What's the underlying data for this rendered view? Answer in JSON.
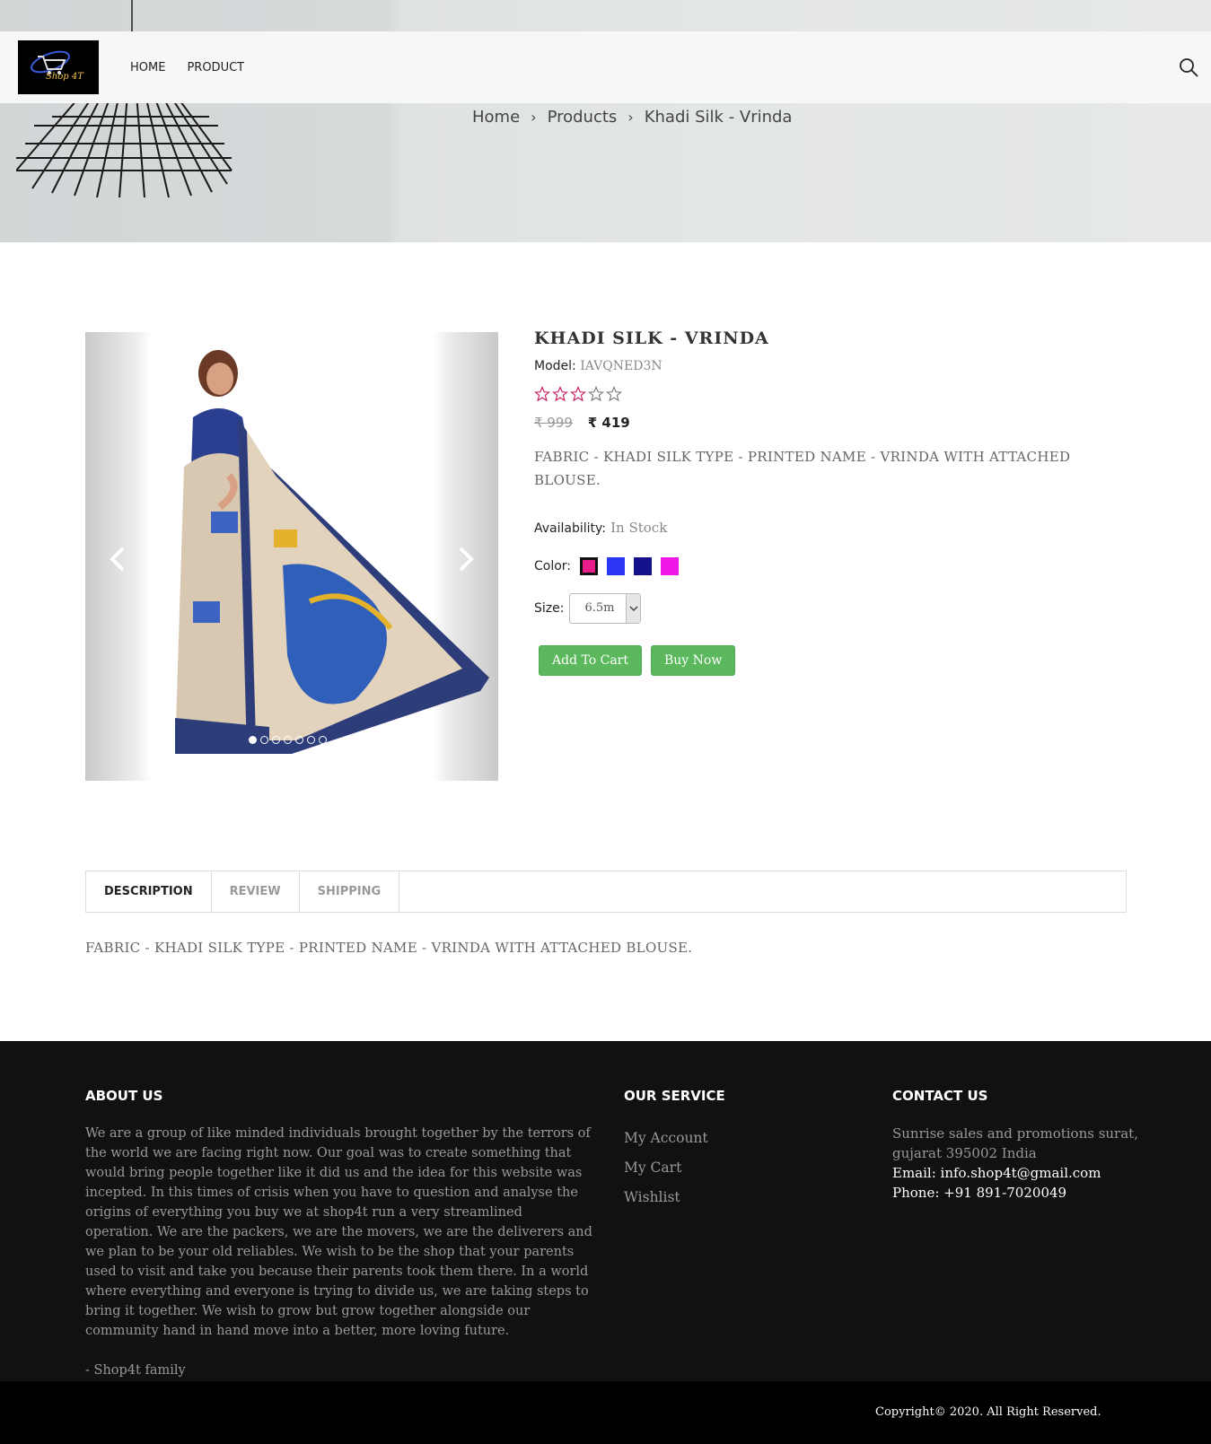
{
  "header": {
    "logo_text": "Shop 4T",
    "nav": [
      "HOME",
      "PRODUCT"
    ]
  },
  "breadcrumb": [
    "Home",
    "Products",
    "Khadi Silk - Vrinda"
  ],
  "product": {
    "title": "KHADI SILK - VRINDA",
    "model_label": "Model:",
    "model": "IAVQNED3N",
    "rating": 0,
    "rating_max": 5,
    "old_price": "₹ 999",
    "new_price": "₹ 419",
    "short_description": "FABRIC - KHADI SILK TYPE - PRINTED NAME - VRINDA WITH ATTACHED BLOUSE.",
    "availability_label": "Availability:",
    "availability": "In Stock",
    "color_label": "Color:",
    "colors": [
      "#e91e8c",
      "#2b36f5",
      "#15128c",
      "#f018e6"
    ],
    "selected_color_index": 0,
    "size_label": "Size:",
    "size_selected": "6.5m",
    "add_to_cart": "Add To Cart",
    "buy_now": "Buy Now",
    "slides_total": 7,
    "active_slide": 1
  },
  "tabs": {
    "items": [
      "DESCRIPTION",
      "REVIEW",
      "SHIPPING"
    ],
    "active": "DESCRIPTION",
    "description": "FABRIC - KHADI SILK TYPE - PRINTED NAME - VRINDA WITH ATTACHED BLOUSE."
  },
  "footer": {
    "about_title": "ABOUT US",
    "about_text": "We are a group of like minded individuals brought together by the terrors of the world we are facing right now. Our goal was to create something that would bring people together like it did us and the idea for this website was incepted. In this times of crisis when you have to question and analyse the origins of everything you buy we at shop4t run a very streamlined operation. We are the packers, we are the movers, we are the deliverers and we plan to be your old reliables. We wish to be the shop that your parents used to visit and take you because their parents took them there. In a world where everything and everyone is trying to divide us, we are taking steps to bring it together. We wish to grow but grow together alongside our community hand in hand move into a better, more loving future.",
    "about_sign": "- Shop4t family",
    "service_title": "OUR SERVICE",
    "service_links": [
      "My Account",
      "My Cart",
      "Wishlist"
    ],
    "contact_title": "CONTACT US",
    "address": "Sunrise sales and promotions surat, gujarat 395002 India",
    "email": "Email: info.shop4t@gmail.com",
    "phone": "Phone: +91 891-7020049",
    "copyright": "Copyright© 2020. All Right Reserved."
  },
  "colors": {
    "button_green": "#5cb85c",
    "star_pink": "#c2185b",
    "footer_bg": "#111111"
  }
}
